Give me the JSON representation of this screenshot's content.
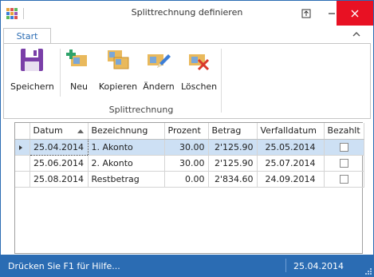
{
  "window": {
    "title": "Splittrechnung definieren"
  },
  "ribbon": {
    "tab_start": "Start",
    "group_label": "Splittrechnung",
    "buttons": {
      "save": "Speichern",
      "new": "Neu",
      "copy": "Kopieren",
      "edit": "Ändern",
      "delete": "Löschen"
    },
    "icons": {
      "save": "floppy-disk-icon",
      "new": "document-add-icon",
      "copy": "document-copy-icon",
      "edit": "document-edit-icon",
      "delete": "document-delete-icon"
    }
  },
  "grid": {
    "columns": [
      "Datum",
      "Bezeichnung",
      "Prozent",
      "Betrag",
      "Verfalldatum",
      "Bezahlt"
    ],
    "sort_column": "Datum",
    "sort_direction": "ascending",
    "rows": [
      {
        "datum": "25.04.2014",
        "bezeichnung": "1. Akonto",
        "prozent": "30.00",
        "betrag": "2'125.90",
        "verfalldatum": "25.05.2014",
        "bezahlt": false,
        "selected": true
      },
      {
        "datum": "25.06.2014",
        "bezeichnung": "2. Akonto",
        "prozent": "30.00",
        "betrag": "2'125.90",
        "verfalldatum": "25.07.2014",
        "bezahlt": false,
        "selected": false
      },
      {
        "datum": "25.08.2014",
        "bezeichnung": "Restbetrag",
        "prozent": "0.00",
        "betrag": "2'834.60",
        "verfalldatum": "24.09.2014",
        "bezahlt": false,
        "selected": false
      }
    ]
  },
  "statusbar": {
    "help": "Drücken Sie F1 für Hilfe...",
    "date": "25.04.2014"
  },
  "colors": {
    "accent": "#2b6cb3",
    "close": "#e81123",
    "selected_row": "#cde0f4"
  }
}
